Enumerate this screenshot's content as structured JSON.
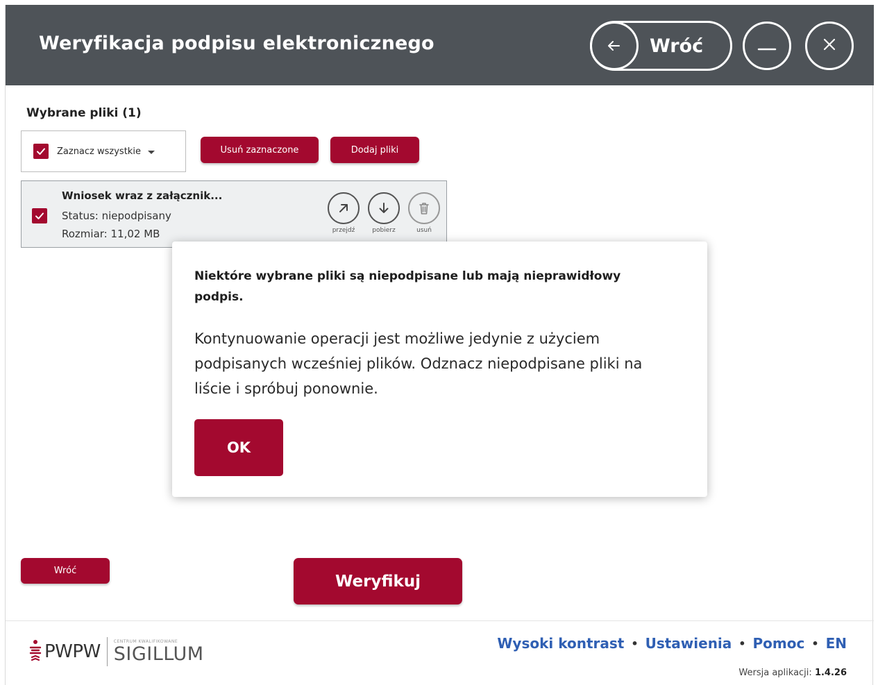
{
  "header": {
    "title": "Weryfikacja podpisu elektronicznego",
    "back_label": "Wróć"
  },
  "files": {
    "section_title": "Wybrane pliki (1)",
    "select_all_label": "Zaznacz wszystkie",
    "remove_selected_label": "Usuń zaznaczone",
    "add_files_label": "Dodaj pliki",
    "items": [
      {
        "checked": true,
        "name": "Wniosek wraz z załącznik...",
        "status": "Status: niepodpisany",
        "size": "Rozmiar: 11,02 MB",
        "actions": {
          "go": "przejdź",
          "download": "pobierz",
          "delete": "usuń"
        }
      }
    ]
  },
  "modal": {
    "heading": "Niektóre wybrane pliki są niepodpisane lub mają nieprawidłowy podpis.",
    "body": "Kontynuowanie operacji jest możliwe jedynie z użyciem podpisanych wcześniej plików. Odznacz niepodpisane pliki na liście i spróbuj ponownie.",
    "ok_label": "OK"
  },
  "actions": {
    "back_label": "Wróć",
    "verify_label": "Weryfikuj"
  },
  "footer": {
    "logo_pwpw": "PWPW",
    "logo_small": "CENTRUM KWALIFIKOWANE",
    "logo_sigillum": "SIGILLUM",
    "links": [
      "Wysoki kontrast",
      "Ustawienia",
      "Pomoc",
      "EN"
    ],
    "version_label": "Wersja aplikacji:",
    "version_value": "1.4.26"
  },
  "colors": {
    "header_bg": "#4e5358",
    "accent": "#a3092f",
    "link": "#2f5fb3"
  }
}
